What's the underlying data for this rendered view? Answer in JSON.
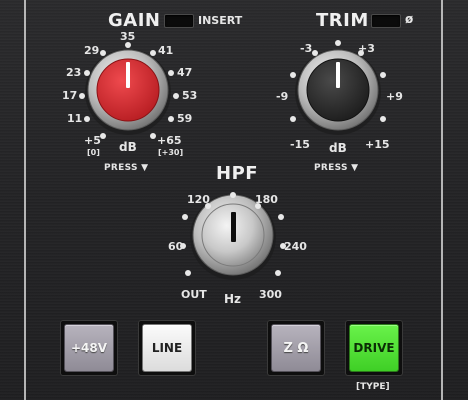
{
  "gain": {
    "title": "GAIN",
    "insert_label": "INSERT",
    "scale": [
      "29",
      "35",
      "41",
      "23",
      "47",
      "17",
      "53",
      "11",
      "59",
      "+5",
      "+65"
    ],
    "sub_low": "[0]",
    "sub_high": "[+30]",
    "unit": "dB",
    "press": "PRESS ▼"
  },
  "trim": {
    "title": "TRIM",
    "phase_label": "ø",
    "scale": [
      "-3",
      "+3",
      "-9",
      "+9",
      "-15",
      "+15"
    ],
    "unit": "dB",
    "press": "PRESS ▼"
  },
  "hpf": {
    "title": "HPF",
    "scale": [
      "120",
      "180",
      "60",
      "240",
      "OUT",
      "300"
    ],
    "unit": "Hz"
  },
  "buttons": {
    "phantom": "+48V",
    "line": "LINE",
    "impedance": "Z Ω",
    "drive": "DRIVE",
    "drive_sub": "[TYPE]"
  },
  "colors": {
    "gain_cap": "#d8282c",
    "trim_cap": "#2f2f2f",
    "hpf_cap": "#c9c9c9",
    "drive_active": "#55e33a"
  }
}
